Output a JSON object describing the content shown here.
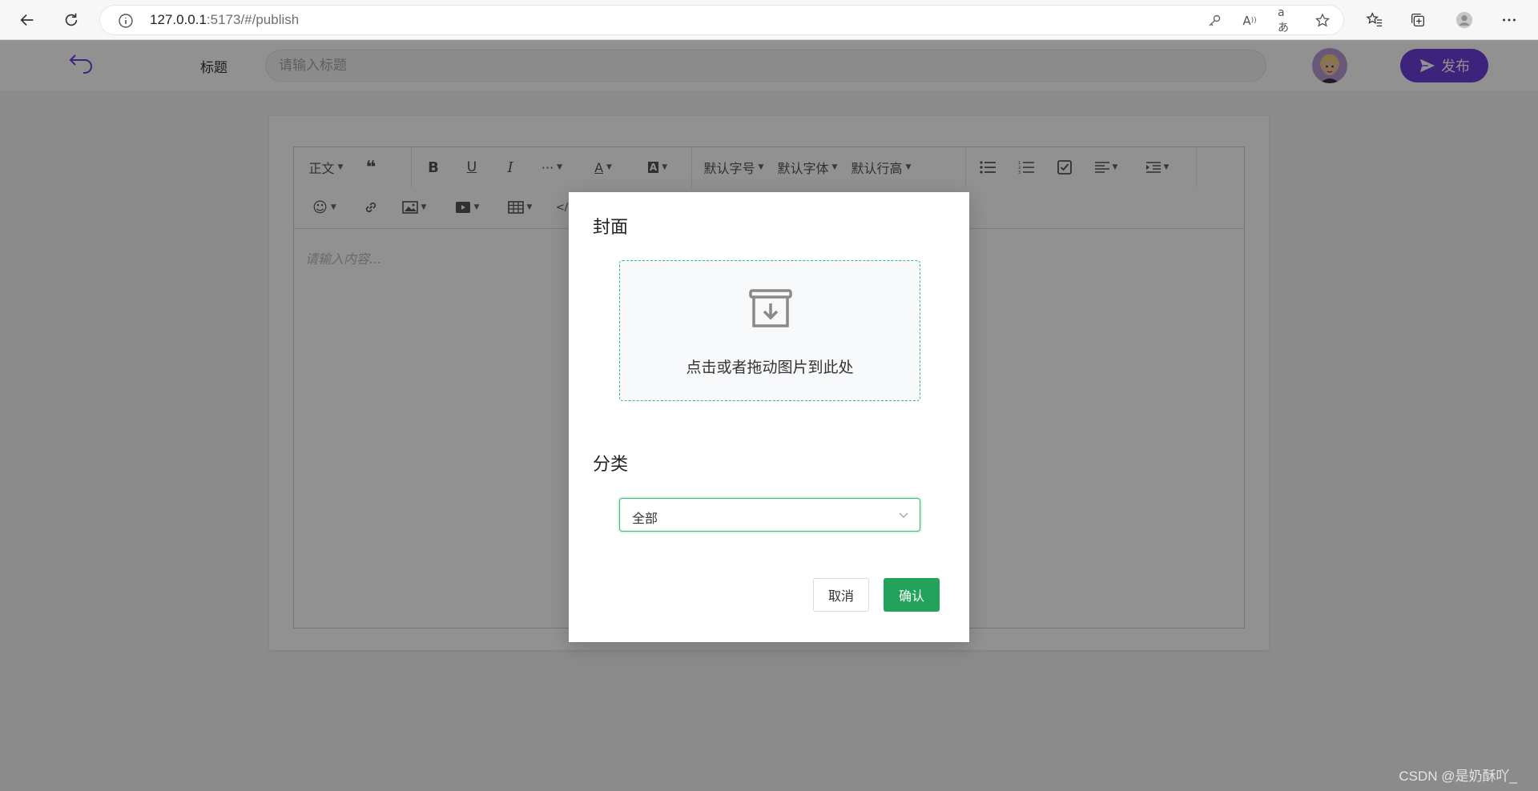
{
  "browser": {
    "url_host": "127.0.0.1",
    "url_rest": ":5173/#/publish"
  },
  "header": {
    "title_label": "标题",
    "title_placeholder": "请输入标题",
    "publish_label": "发布",
    "accent_color": "#6c3ed8"
  },
  "toolbar": {
    "row1": [
      {
        "name": "paragraph-select",
        "label": "正文",
        "caret": true
      },
      {
        "name": "quote-button",
        "icon": "quote-icon"
      },
      {
        "name": "bold-button",
        "icon": "bold-icon"
      },
      {
        "name": "underline-button",
        "icon": "underline-icon"
      },
      {
        "name": "italic-button",
        "icon": "italic-icon"
      },
      {
        "name": "more-button",
        "icon": "more-icon",
        "caret": true
      },
      {
        "name": "font-color-button",
        "icon": "font-color-icon",
        "caret": true
      },
      {
        "name": "bg-color-button",
        "icon": "bg-color-icon",
        "caret": true
      },
      {
        "name": "font-size-select",
        "label": "默认字号",
        "caret": true
      },
      {
        "name": "font-family-select",
        "label": "默认字体",
        "caret": true
      },
      {
        "name": "line-height-select",
        "label": "默认行高",
        "caret": true
      },
      {
        "name": "bulleted-list-button",
        "icon": "bulleted-list-icon"
      },
      {
        "name": "numbered-list-button",
        "icon": "numbered-list-icon"
      },
      {
        "name": "todo-button",
        "icon": "todo-icon"
      },
      {
        "name": "align-button",
        "icon": "align-icon",
        "caret": true
      },
      {
        "name": "indent-button",
        "icon": "indent-icon",
        "caret": true
      }
    ],
    "row2": [
      {
        "name": "emoji-button",
        "icon": "emoji-icon",
        "caret": true
      },
      {
        "name": "link-button",
        "icon": "link-icon"
      },
      {
        "name": "image-button",
        "icon": "image-icon",
        "caret": true
      },
      {
        "name": "video-button",
        "icon": "video-icon",
        "caret": true
      },
      {
        "name": "table-button",
        "icon": "table-icon",
        "caret": true
      },
      {
        "name": "code-button",
        "icon": "code-icon"
      }
    ]
  },
  "editor": {
    "placeholder": "请输入内容..."
  },
  "dialog": {
    "cover_heading": "封面",
    "upload_text": "点击或者拖动图片到此处",
    "category_heading": "分类",
    "category_value": "全部",
    "cancel_label": "取消",
    "confirm_label": "确认",
    "primary_color": "#22a25a"
  },
  "watermark": "CSDN @是奶酥吖_"
}
